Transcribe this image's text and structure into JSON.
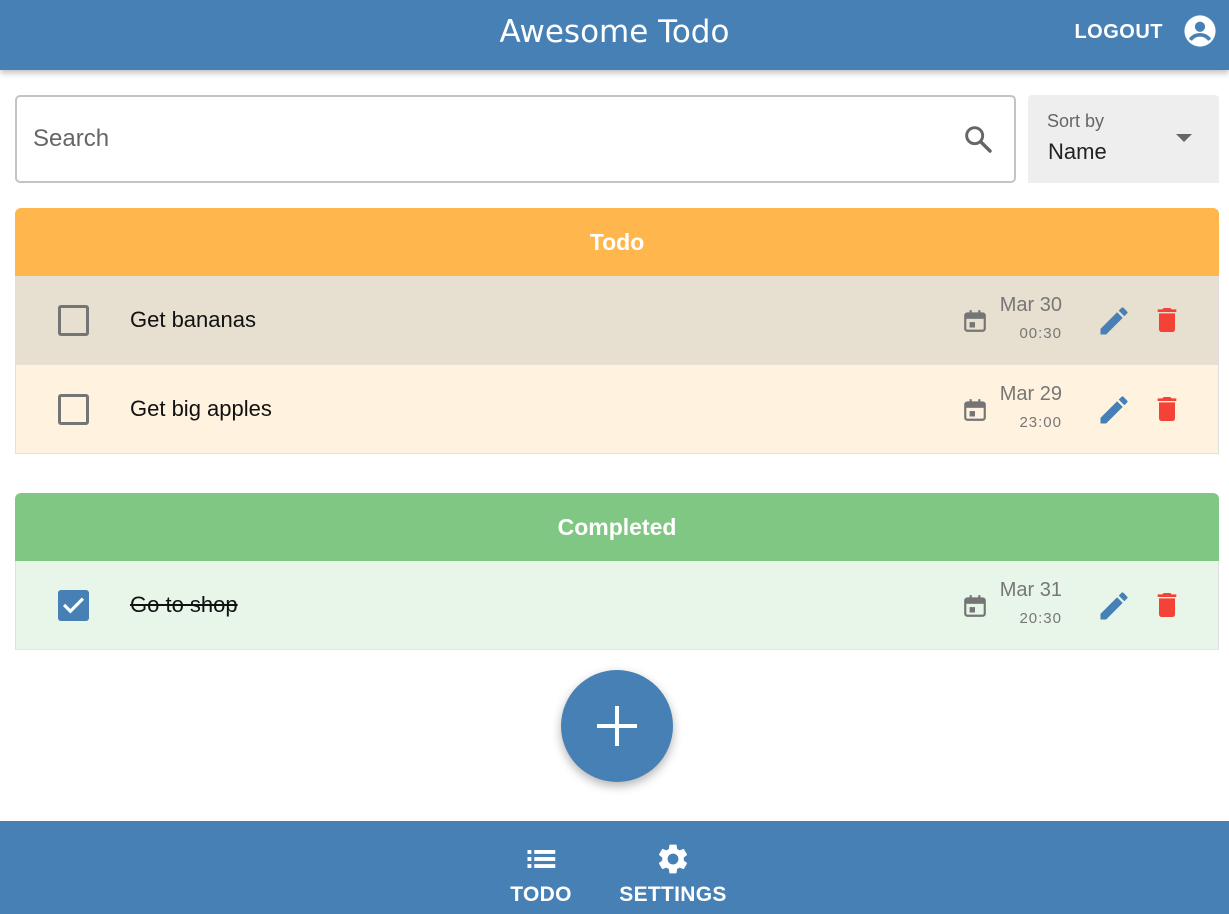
{
  "header": {
    "title": "Awesome Todo",
    "logout_label": "LOGOUT",
    "account_icon": "account-circle-icon"
  },
  "search": {
    "placeholder": "Search",
    "value": "",
    "icon": "search-icon"
  },
  "sort": {
    "label": "Sort by",
    "selected": "Name",
    "icon": "arrow-drop-down-icon"
  },
  "sections": {
    "todo": {
      "title": "Todo",
      "color": "#ffb74d",
      "items": [
        {
          "text": "Get bananas",
          "date": "Mar 30",
          "time": "00:30",
          "completed": false
        },
        {
          "text": "Get big apples",
          "date": "Mar 29",
          "time": "23:00",
          "completed": false
        }
      ]
    },
    "completed": {
      "title": "Completed",
      "color": "#81c784",
      "items": [
        {
          "text": "Go to shop",
          "date": "Mar 31",
          "time": "20:30",
          "completed": true
        }
      ]
    }
  },
  "fab": {
    "icon": "add-icon"
  },
  "bottom_nav": {
    "items": [
      {
        "label": "TODO",
        "icon": "list-icon"
      },
      {
        "label": "SETTINGS",
        "icon": "settings-gear-icon"
      }
    ]
  },
  "colors": {
    "primary": "#4680b5",
    "todo_header": "#ffb74d",
    "completed_header": "#81c784",
    "delete": "#f44336",
    "edit": "#4680b5"
  }
}
